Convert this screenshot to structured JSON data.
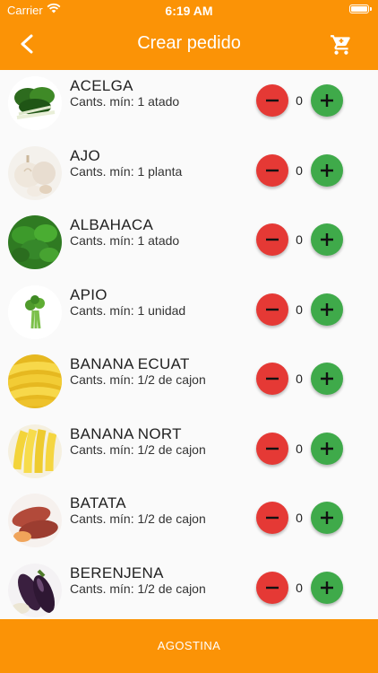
{
  "status_bar": {
    "carrier": "Carrier",
    "time": "6:19 AM"
  },
  "header": {
    "title": "Crear pedido",
    "back_icon": "back-arrow-icon",
    "cart_icon": "cart-icon"
  },
  "colors": {
    "accent": "#fb9306",
    "minus": "#e53935",
    "plus": "#3faa4a"
  },
  "products": [
    {
      "name": "ACELGA",
      "min_qty": "Cants. mín: 1 atado",
      "qty": "0"
    },
    {
      "name": "AJO",
      "min_qty": "Cants. mín: 1 planta",
      "qty": "0"
    },
    {
      "name": "ALBAHACA",
      "min_qty": "Cants. mín: 1 atado",
      "qty": "0"
    },
    {
      "name": "APIO",
      "min_qty": "Cants. mín: 1 unidad",
      "qty": "0"
    },
    {
      "name": "BANANA ECUAT",
      "min_qty": "Cants. mín: 1/2 de cajon",
      "qty": "0"
    },
    {
      "name": "BANANA NORT",
      "min_qty": "Cants. mín: 1/2 de cajon",
      "qty": "0"
    },
    {
      "name": "BATATA",
      "min_qty": "Cants. mín: 1/2 de cajon",
      "qty": "0"
    },
    {
      "name": "BERENJENA",
      "min_qty": "Cants. mín: 1/2 de cajon",
      "qty": "0"
    }
  ],
  "footer": {
    "label": "AGOSTINA"
  }
}
